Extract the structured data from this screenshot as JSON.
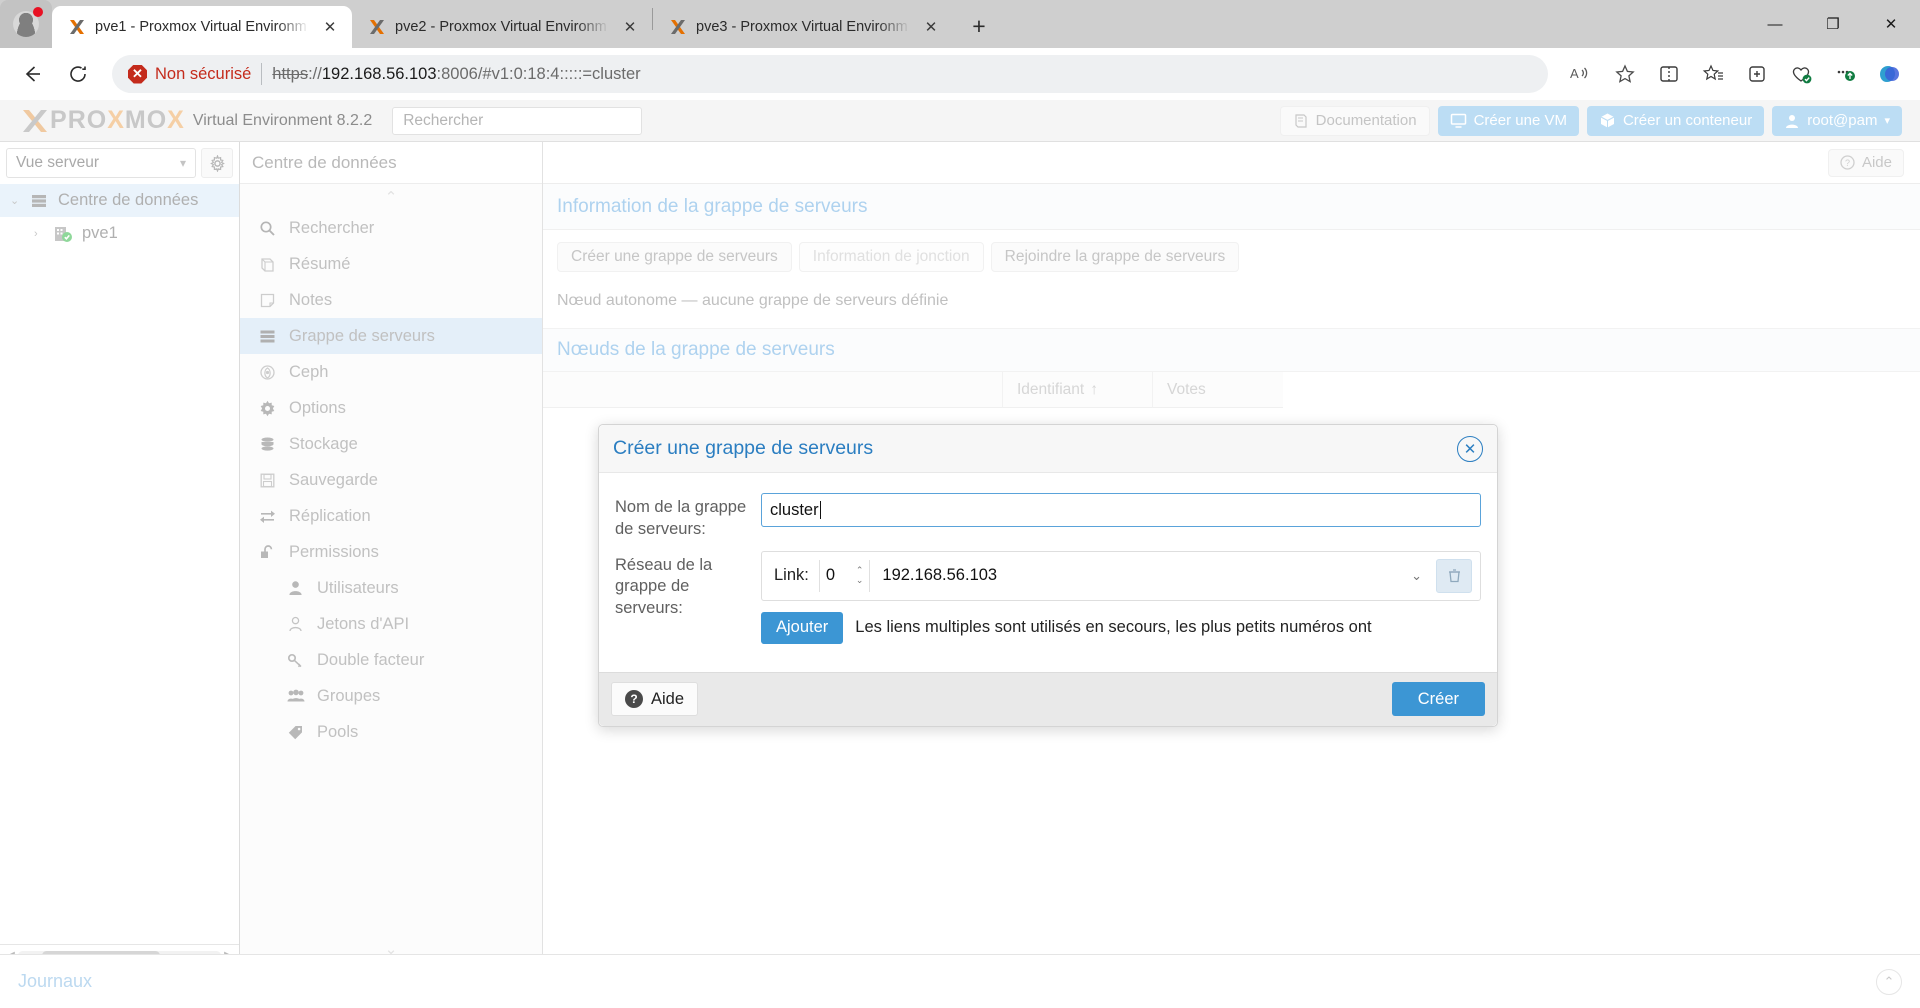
{
  "browser": {
    "tabs": [
      {
        "title": "pve1 - Proxmox Virtual Environm",
        "close": "✕",
        "active": true
      },
      {
        "title": "pve2 - Proxmox Virtual Environm",
        "close": "✕",
        "active": false
      },
      {
        "title": "pve3 - Proxmox Virtual Environm",
        "close": "✕",
        "active": false
      }
    ],
    "new_tab_label": "+",
    "window_controls": {
      "minimize": "—",
      "maximize": "❐",
      "close": "✕"
    },
    "back_label": "←",
    "reload_label": "⟳",
    "security_label": "Non sécurisé",
    "security_icon_glyph": "✕",
    "url": {
      "scheme": "https",
      "separator": "://",
      "host": "192.168.56.103",
      "rest": ":8006/#v1:0:18:4:::::=cluster"
    }
  },
  "pve": {
    "brand": "PROXMOX",
    "brand_x": "X",
    "brand_letters": [
      "P",
      "R",
      "O",
      "X",
      "M",
      "O",
      "X"
    ],
    "product": "Virtual Environment 8.2.2",
    "search_placeholder": "Rechercher",
    "header_buttons": [
      {
        "label": "Documentation",
        "icon": "book-icon",
        "style": "light"
      },
      {
        "label": "Créer une VM",
        "icon": "monitor-icon",
        "style": "blue"
      },
      {
        "label": "Créer un conteneur",
        "icon": "box-icon",
        "style": "blue"
      },
      {
        "label": "root@pam",
        "icon": "user-icon",
        "style": "blue"
      }
    ],
    "tree": {
      "view_selector": "Vue serveur",
      "gear_icon": "gear-icon",
      "items": [
        {
          "label": "Centre de données",
          "icon": "datacenter-icon",
          "selected": true,
          "child": false,
          "arrow": "⌄"
        },
        {
          "label": "pve1",
          "icon": "node-icon",
          "selected": false,
          "child": true,
          "arrow": "›"
        }
      ]
    },
    "nav": {
      "title": "Centre de données",
      "items": [
        {
          "label": "Rechercher",
          "icon": "search-icon",
          "active": false,
          "sub": false
        },
        {
          "label": "Résumé",
          "icon": "book-icon",
          "active": false,
          "sub": false
        },
        {
          "label": "Notes",
          "icon": "note-icon",
          "active": false,
          "sub": false
        },
        {
          "label": "Grappe de serveurs",
          "icon": "cluster-icon",
          "active": true,
          "sub": false
        },
        {
          "label": "Ceph",
          "icon": "ceph-icon",
          "active": false,
          "sub": false
        },
        {
          "label": "Options",
          "icon": "gear-icon",
          "active": false,
          "sub": false
        },
        {
          "label": "Stockage",
          "icon": "database-icon",
          "active": false,
          "sub": false
        },
        {
          "label": "Sauvegarde",
          "icon": "floppy-icon",
          "active": false,
          "sub": false
        },
        {
          "label": "Réplication",
          "icon": "replication-icon",
          "active": false,
          "sub": false
        },
        {
          "label": "Permissions",
          "icon": "unlock-icon",
          "active": false,
          "sub": false
        },
        {
          "label": "Utilisateurs",
          "icon": "user-filled-icon",
          "active": false,
          "sub": true
        },
        {
          "label": "Jetons d'API",
          "icon": "user-outline-icon",
          "active": false,
          "sub": true
        },
        {
          "label": "Double facteur",
          "icon": "key-icon",
          "active": false,
          "sub": true
        },
        {
          "label": "Groupes",
          "icon": "groups-icon",
          "active": false,
          "sub": true
        },
        {
          "label": "Pools",
          "icon": "tag-icon",
          "active": false,
          "sub": true
        }
      ]
    },
    "content": {
      "breadcrumb": "Centre de données",
      "help_label": "Aide",
      "section1_title": "Information de la grappe de serveurs",
      "buttons": [
        {
          "label": "Créer une grappe de serveurs",
          "disabled": false
        },
        {
          "label": "Information de jonction",
          "disabled": true
        },
        {
          "label": "Rejoindre la grappe de serveurs",
          "disabled": false
        }
      ],
      "standalone_note": "Nœud autonome — aucune grappe de serveurs définie",
      "section2_title": "Nœuds de la grappe de serveurs",
      "grid_columns": [
        {
          "label": "",
          "key": "nom"
        },
        {
          "label": "Identifiant",
          "sort": "↑",
          "key": "id"
        },
        {
          "label": "Votes",
          "key": "votes"
        }
      ]
    },
    "journaux": {
      "label": "Journaux",
      "chevron": "⌃"
    }
  },
  "modal": {
    "title": "Créer une grappe de serveurs",
    "close_glyph": "✕",
    "name_label": "Nom de la grappe de serveurs:",
    "name_value": "cluster",
    "network_label": "Réseau de la grappe de serveurs:",
    "link_label": "Link:",
    "link_number": "0",
    "link_address": "192.168.56.103",
    "delete_icon": "trash-icon",
    "spin_up": "⌃",
    "spin_down": "⌄",
    "combo_chevron": "⌄",
    "add_button": "Ajouter",
    "hint": "Les liens multiples sont utilisés en secours, les plus petits numéros ont",
    "help_button": "Aide",
    "help_glyph": "?",
    "create_button": "Créer"
  },
  "colors": {
    "accent_blue": "#3c96d4",
    "title_blue": "#2b7ec1",
    "insecure_red": "#c42b1c",
    "proxmox_orange": "#e57000"
  }
}
